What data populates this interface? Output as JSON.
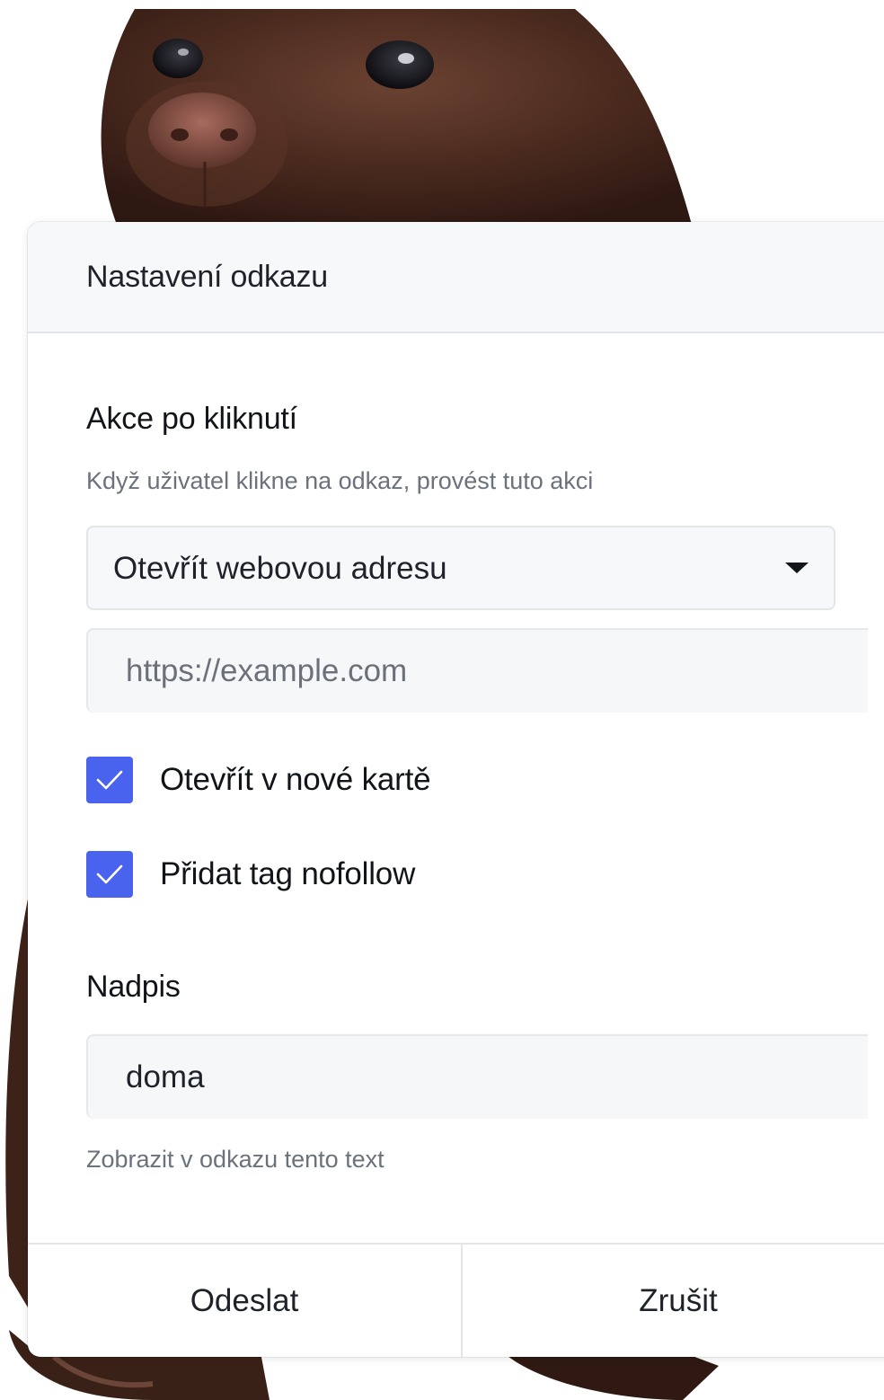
{
  "background": {
    "subject": "chocolate-labrador-puppy",
    "fur_color": "#4a2a1e"
  },
  "dialog": {
    "title": "Nastavení odkazu",
    "action_section": {
      "heading": "Akce po kliknutí",
      "help": "Když uživatel klikne na odkaz, provést tuto akci",
      "select_value": "Otevřít webovou adresu",
      "url_placeholder": "https://example.com",
      "url_value": ""
    },
    "options": [
      {
        "label": "Otevřít v nové kartě",
        "checked": true
      },
      {
        "label": "Přidat tag nofollow",
        "checked": true
      }
    ],
    "caption_section": {
      "heading": "Nadpis",
      "value": "doma",
      "help": "Zobrazit v odkazu tento text"
    },
    "footer": {
      "submit_label": "Odeslat",
      "cancel_label": "Zrušit"
    }
  },
  "colors": {
    "checkbox_accent": "#4a63ef",
    "header_bg": "#f7f8fa",
    "text_primary": "#111418",
    "text_muted": "#6c727c"
  }
}
